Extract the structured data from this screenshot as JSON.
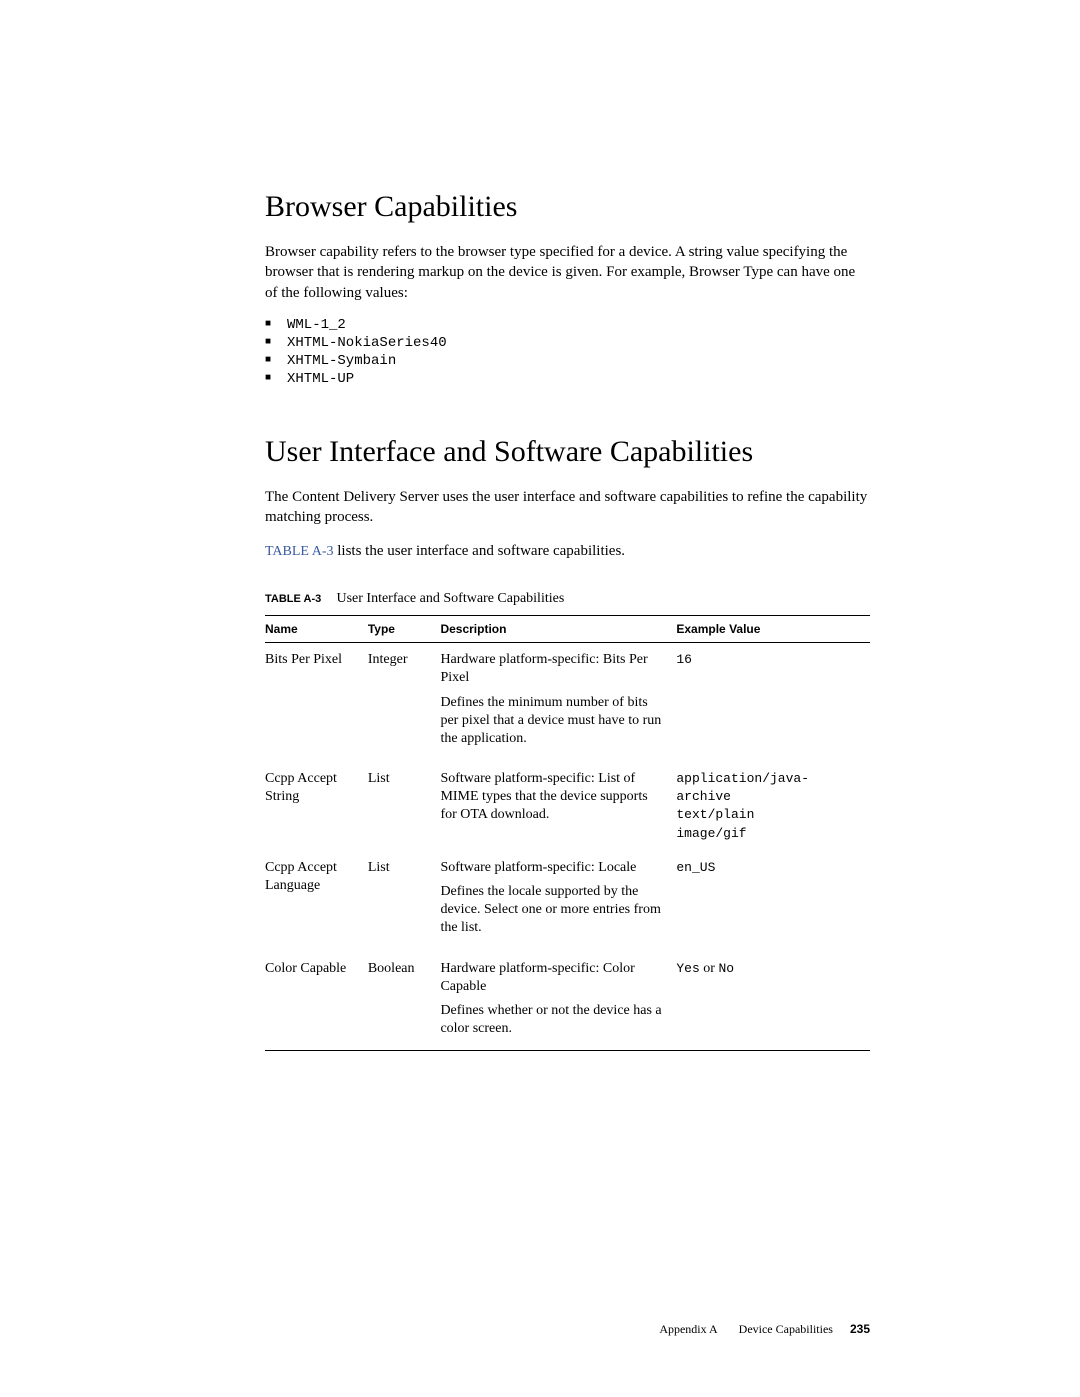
{
  "section1": {
    "title": "Browser Capabilities",
    "para": "Browser capability refers to the browser type specified for a device. A string value specifying the browser that is rendering markup on the device is given. For example, Browser Type can have one of the following values:",
    "bullets": [
      "WML-1_2",
      "XHTML-NokiaSeries40",
      "XHTML-Symbain",
      "XHTML-UP"
    ]
  },
  "section2": {
    "title": "User Interface and Software Capabilities",
    "para1": "The Content Delivery Server uses the user interface and software capabilities to refine the capability matching process.",
    "ref_label": "TABLE A-3",
    "ref_rest": " lists the user interface and software capabilities."
  },
  "table": {
    "label": "TABLE A-3",
    "title": "User Interface and Software Capabilities",
    "headers": [
      "Name",
      "Type",
      "Description",
      "Example Value"
    ],
    "rows": [
      {
        "name": "Bits Per Pixel",
        "type": "Integer",
        "desc1": "Hardware platform-specific: Bits Per Pixel",
        "desc2": "Defines the minimum number of bits per pixel that a device must have to run the application.",
        "example_mono": "16",
        "example_plain": ""
      },
      {
        "name": "Ccpp Accept String",
        "type": "List",
        "desc1": "Software platform-specific: List of MIME types that the device supports for OTA download.",
        "desc2": "",
        "example_mono": "application/java-archive\ntext/plain\nimage/gif",
        "example_plain": ""
      },
      {
        "name": "Ccpp Accept Language",
        "type": "List",
        "desc1": "Software platform-specific: Locale",
        "desc2": "Defines the locale supported by the device. Select one or more entries from the list.",
        "example_mono": "en_US",
        "example_plain": ""
      },
      {
        "name": "Color Capable",
        "type": "Boolean",
        "desc1": "Hardware platform-specific: Color Capable",
        "desc2": "Defines whether or not the device has a color screen.",
        "example_mono": "Yes",
        "example_plain_mid": " or ",
        "example_mono2": "No"
      }
    ]
  },
  "footer": {
    "appendix": "Appendix A",
    "chapter": "Device Capabilities",
    "page": "235"
  }
}
